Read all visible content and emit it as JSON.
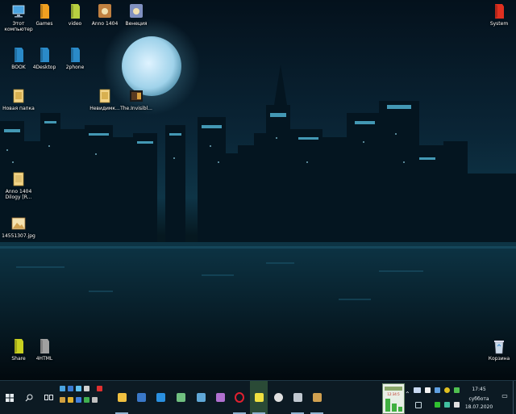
{
  "desktop_icons_left": [
    {
      "label": "Этот компьютер",
      "icon": "computer-icon",
      "color": "#4aa3e0"
    },
    {
      "label": "Games",
      "icon": "folder-icon",
      "color": "#f0a020"
    },
    {
      "label": "video",
      "icon": "folder-icon",
      "color": "#b8d040"
    },
    {
      "label": "Anno 1404",
      "icon": "game-icon",
      "color": "#c08040"
    },
    {
      "label": "Венеция",
      "icon": "game-icon",
      "color": "#8090c0"
    },
    {
      "label": "BOOK",
      "icon": "folder-icon",
      "color": "#2a8ac8"
    },
    {
      "label": "4Desktop",
      "icon": "folder-icon",
      "color": "#2a8ac8"
    },
    {
      "label": "2phone",
      "icon": "folder-icon",
      "color": "#2a8ac8"
    },
    {
      "label": "Новая папка",
      "icon": "folder-image-icon",
      "color": "#d8b050"
    },
    {
      "label": "Невидимк...",
      "icon": "folder-image-icon",
      "color": "#d8b050"
    },
    {
      "label": "The.Invisibl...",
      "icon": "video-file-icon",
      "color": "#5a3a20"
    },
    {
      "label": "Anno 1404 Dilogy [R...",
      "icon": "folder-image-icon",
      "color": "#e0c070"
    },
    {
      "label": "14551307.jpg",
      "icon": "image-file-icon",
      "color": "#d0a050"
    },
    {
      "label": "Share",
      "icon": "folder-icon",
      "color": "#c8d020"
    },
    {
      "label": "4HTML",
      "icon": "folder-icon",
      "color": "#a0a0a0"
    }
  ],
  "desktop_icons_right": [
    {
      "label": "System",
      "icon": "folder-icon",
      "color": "#e03020"
    },
    {
      "label": "Корзина",
      "icon": "recycle-bin-icon",
      "color": "#c8d8e8"
    }
  ],
  "taskbar": {
    "start_icon": "windows-start-icon",
    "search_icon": "search-icon",
    "taskview_icon": "task-view-icon",
    "pinned": [
      {
        "name": "file-explorer-icon",
        "color": "#f0c040"
      },
      {
        "name": "powershell-icon",
        "color": "#3a78c8"
      },
      {
        "name": "arrow-app-icon",
        "color": "#2a90e0"
      },
      {
        "name": "notepad-icon",
        "color": "#70c080"
      },
      {
        "name": "paint-icon",
        "color": "#60a8d8"
      },
      {
        "name": "photos-icon",
        "color": "#b070d0"
      },
      {
        "name": "opera-icon",
        "color": "#e02030"
      },
      {
        "name": "sticky-notes-icon",
        "color": "#f0e040"
      },
      {
        "name": "clock-icon",
        "color": "#e0e0e0"
      },
      {
        "name": "drives-icon",
        "color": "#c0c8d0"
      },
      {
        "name": "photo-viewer-icon",
        "color": "#d0a050"
      }
    ],
    "clock": {
      "time": "17:45",
      "day": "суббота",
      "date": "18.07.2020"
    },
    "widget": {
      "text": "12:34:5"
    }
  }
}
